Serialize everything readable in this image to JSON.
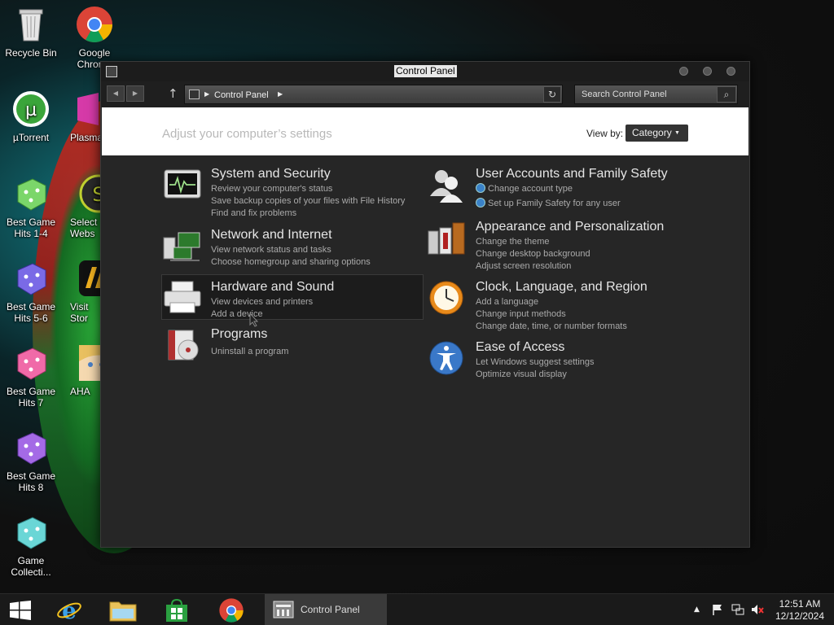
{
  "desktop": {
    "icons": [
      {
        "label": "Recycle Bin",
        "icon": "recycle-bin-icon"
      },
      {
        "label": "Google Chrome",
        "icon": "chrome-icon"
      },
      {
        "label": "µTorrent",
        "icon": "utorrent-icon"
      },
      {
        "label": "Plasma",
        "icon": "plasma-icon"
      },
      {
        "label": "Best Game Hits 1-4",
        "icon": "dice-icon"
      },
      {
        "label": "Select Webs",
        "icon": "select-icon"
      },
      {
        "label": "Best Game Hits 5-6",
        "icon": "dice-icon"
      },
      {
        "label": "Visit Stor",
        "icon": "store-icon"
      },
      {
        "label": "Best Game Hits 7",
        "icon": "dice-icon"
      },
      {
        "label": "AHA",
        "icon": "anime-icon"
      },
      {
        "label": "Best Game Hits 8",
        "icon": "dice-icon"
      },
      {
        "label": "Game Collecti...",
        "icon": "dice-icon"
      }
    ]
  },
  "window": {
    "title": "Control Panel",
    "breadcrumb": "Control Panel",
    "search_placeholder": "Search Control Panel",
    "heading": "Adjust your computer’s settings",
    "view_by_label": "View by:",
    "view_by_value": "Category",
    "categories": [
      {
        "title": "System and Security",
        "icon": "system-security-icon",
        "links": [
          "Review your computer's status",
          "Save backup copies of your files with File History",
          "Find and fix problems"
        ]
      },
      {
        "title": "Network and Internet",
        "icon": "network-icon",
        "links": [
          "View network status and tasks",
          "Choose homegroup and sharing options"
        ]
      },
      {
        "title": "Hardware and Sound",
        "icon": "printer-icon",
        "links": [
          "View devices and printers",
          "Add a device"
        ]
      },
      {
        "title": "Programs",
        "icon": "programs-icon",
        "links": [
          "Uninstall a program"
        ]
      },
      {
        "title": "User Accounts and Family Safety",
        "icon": "users-icon",
        "links": [
          "Change account type",
          "Set up Family Safety for any user"
        ]
      },
      {
        "title": "Appearance and Personalization",
        "icon": "appearance-icon",
        "links": [
          "Change the theme",
          "Change desktop background",
          "Adjust screen resolution"
        ]
      },
      {
        "title": "Clock, Language, and Region",
        "icon": "clock-icon",
        "links": [
          "Add a language",
          "Change input methods",
          "Change date, time, or number formats"
        ]
      },
      {
        "title": "Ease of Access",
        "icon": "accessibility-icon",
        "links": [
          "Let Windows suggest settings",
          "Optimize visual display"
        ]
      }
    ]
  },
  "taskbar": {
    "active_label": "Control Panel",
    "time": "12:51 AM",
    "date": "12/12/2024"
  }
}
